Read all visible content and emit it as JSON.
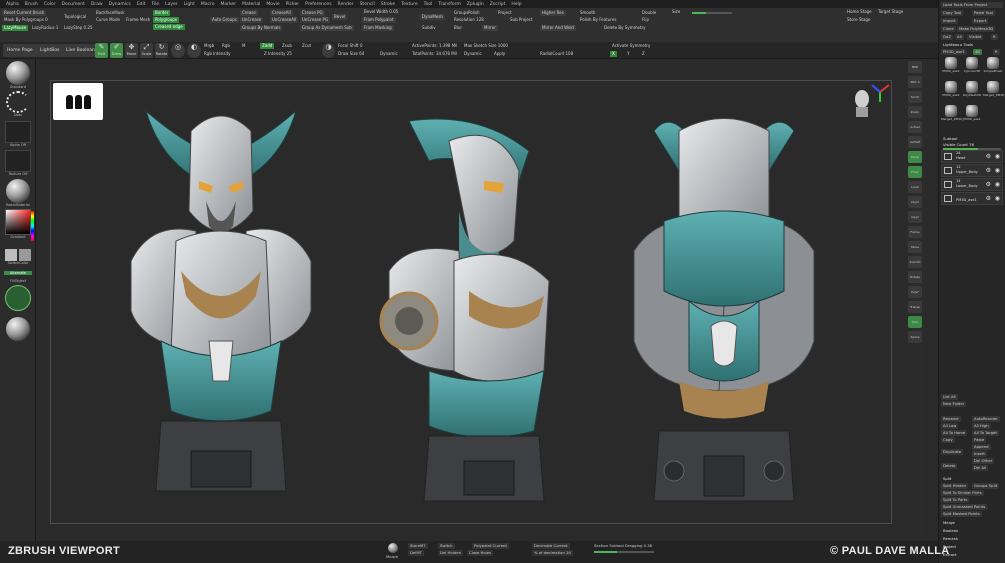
{
  "menu": [
    "Alpha",
    "Brush",
    "Color",
    "Document",
    "Draw",
    "Dynamics",
    "Edit",
    "File",
    "Layer",
    "Light",
    "Macro",
    "Marker",
    "Material",
    "Movie",
    "Picker",
    "Preferences",
    "Render",
    "Stencil",
    "Stroke",
    "Texture",
    "Tool",
    "Transform",
    "Zplugin",
    "Zscript",
    "Help"
  ],
  "top": {
    "reset_brush": "Reset Current Brush",
    "mask_by_poly": "Mask By Polygroups 0",
    "topological": "Topological",
    "rest": "Rest",
    "backface": "BackfaceMask",
    "curve_mode": "Curve Mode",
    "frame_mesh": "Frame Mesh",
    "border": "Border",
    "polygroups": "Polygroups",
    "creased_edge": "Creased edge",
    "auto_groups": "Auto Groups",
    "crease": "Crease",
    "uncrease": "UnCrease",
    "creaseall": "CreaseAll",
    "uncreaseall": "UnCreaseAll",
    "crease_pg": "Crease PG",
    "uncrease_pg": "UnCrease PG",
    "groups_by_normals": "Groups By Normals",
    "group_as_dynamesh": "Group As Dynamesh Sub",
    "bevel": "Bevel",
    "bevel_width": "Bevel Width 0.05",
    "from_polypaint": "From Polypaint",
    "from_masking": "From Masking",
    "dynamesh": "DynaMesh",
    "groups": "Groups",
    "polish": "Polish",
    "project": "Project",
    "resolution": "Resolution 128",
    "sub_project": "Sub Project",
    "subdiv": "Subdiv",
    "blur": "Blur",
    "mirror": "Mirror",
    "higher_res": "Higher Res",
    "mirror_weld": "Mirror And Weld",
    "smooth": "Smooth",
    "polish_by_features": "Polish By Features",
    "double": "Double",
    "flip": "Flip",
    "size": "Size",
    "delete_by_symmetry": "Delete By Symmetry",
    "home_stage": "Home Stage",
    "target_stage": "Target Stage",
    "store_stage": "Store Stage",
    "lazy_mouse": "LazyMouse",
    "lazy_radius": "LazyRadius 1",
    "lazy_step": "LazyStep 0.25"
  },
  "shelf": {
    "home_page": "Home Page",
    "lightbox": "LightBox",
    "live_boolean": "Live Boolean",
    "edit": "Edit",
    "draw": "Draw",
    "move": "Move",
    "scale": "Scale",
    "rotate": "Rotate",
    "mrgb": "Mrgb",
    "rgb": "Rgb",
    "m": "M",
    "zadd": "Zadd",
    "zsub": "Zsub",
    "zcut": "Zcut",
    "rgb_intensity": "Rgb Intensity",
    "z_intensity": "Z Intensity 25",
    "focal_shift": "Focal Shift 0",
    "draw_size": "Draw Size 64",
    "dynamic": "Dynamic",
    "active_points": "ActivePoints: 1.398 Mil",
    "total_points": "TotalPoints: 34.678 Mil",
    "max_sketch": "Max Sketch Size 1000",
    "dynamic2": "Dynamic",
    "apply": "Apply",
    "activate_symmetry": "Activate Symmetry",
    "x": "X",
    "y": "Y",
    "z": "Z",
    "r": "R",
    "radial_count": "RadialCount 108",
    "scroll": "Scroll",
    "zoom": "Zoom"
  },
  "left": {
    "standard": "Standard",
    "dots": "Dots",
    "alpha_off": "Alpha Off",
    "texture_off": "Texture Off",
    "basic": "BasicMaterial",
    "gradient": "Gradient",
    "switch_color": "SwitchColor",
    "alternate": "Alternate",
    "fillobject": "FillObject"
  },
  "right_icons": [
    "BPR",
    "SPix 3",
    "Scroll",
    "Zoom",
    "Actual",
    "AAHalf",
    "Persp",
    "Floor",
    "Local",
    "LSym",
    "Gxyz",
    "Frame",
    "Move",
    "ZoomD",
    "Rotate",
    "PolyF",
    "Transp",
    "Solo",
    "Xpose"
  ],
  "tray": {
    "load_tools": "Load Tools From Project",
    "copy_tool": "Copy Tool",
    "paste_tool": "Paste Tool",
    "import": "Import",
    "export": "Export",
    "clone": "Clone",
    "make_polymesh": "Make PolyMesh3D",
    "goz": "GoZ",
    "all": "All",
    "visible": "Visible",
    "r": "R",
    "lightbox_tools": "Lightbox ▸ Tools",
    "pm3d": "PM3D_ase1",
    "pm3d_value": "48",
    "r_tool": "R",
    "thumbs": [
      "PM3D_ase1",
      "Cylinder3D",
      "SimpleBrush",
      "PM3D_ase1",
      "PolyMesh3D",
      "Merged_PM3D_",
      "Merged_PM3D_",
      "PM3D_ase1"
    ],
    "subtool": "Subtool",
    "visible_count": "Visible Count 76",
    "subtools": [
      {
        "name": "Head",
        "count": "24"
      },
      {
        "name": "Upper_Body",
        "count": "12"
      },
      {
        "name": "Lower_Body",
        "count": "14"
      },
      {
        "name": "PM3D_ase1",
        "count": ""
      }
    ],
    "list_all": "List All",
    "new_folder": "New Folder",
    "rename": "Rename",
    "autoreorder": "AutoReorder",
    "all_low": "All Low",
    "all_high": "All High",
    "all_to_home": "All To Home",
    "all_to_target": "All To Target",
    "copy": "Copy",
    "paste": "Paste",
    "duplicate": "Duplicate",
    "append": "Append",
    "insert": "Insert",
    "delete": "Delete",
    "del_other": "Del Other",
    "del_all": "Del All",
    "split": "Split",
    "split_hidden": "Split Hidden",
    "groups_split": "Groups Split",
    "split_similar": "Split To Similar Parts",
    "split_parts": "Split To Parts",
    "split_unmasked": "Split Unmasked Points",
    "split_masked": "Split Masked Points",
    "merge": "Merge",
    "boolean": "Boolean",
    "remesh": "Remesh",
    "project": "Project",
    "extract": "Extract"
  },
  "bottom": {
    "morph": "Morph",
    "store_mt": "StoreMT",
    "delmt": "DelMT",
    "switch": "Switch",
    "del_hidden": "Del Hidden",
    "close_holes": "Close Holes",
    "polypersonal": "Polypaint Current",
    "decimate": "Decimate Current",
    "pct_decimation": "% of decimation 20",
    "section": "Section Subtool Dragging 0.38"
  },
  "captions": {
    "left": "ZBRUSH VIEWPORT",
    "right": "© PAUL DAVE MALLA"
  },
  "colors": {
    "accent_green": "#3f8e47",
    "teal_armor": "#3f8f92",
    "brass": "#a8834f",
    "silver": "#c9ccd0"
  }
}
